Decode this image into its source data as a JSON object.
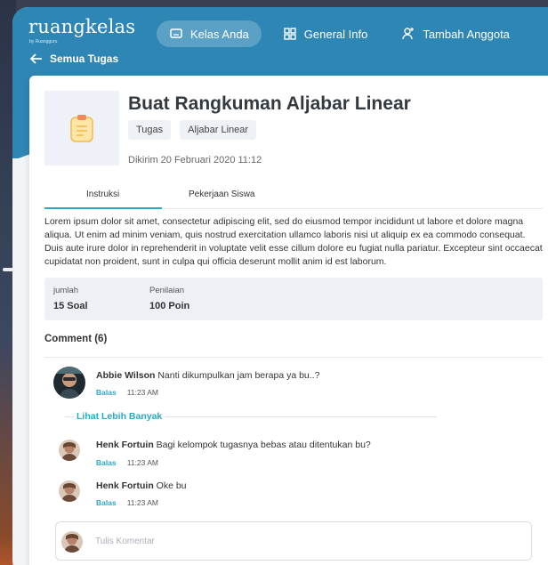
{
  "app": {
    "logo": "ruangkelas",
    "logo_sub": "by Ruangguru"
  },
  "nav": [
    {
      "label": "Kelas Anda",
      "icon": "monitor-icon",
      "active": true
    },
    {
      "label": "General Info",
      "icon": "grid-icon",
      "active": false
    },
    {
      "label": "Tambah Anggota",
      "icon": "add-user-icon",
      "active": false
    }
  ],
  "back": {
    "label": "Semua Tugas"
  },
  "assignment": {
    "title": "Buat Rangkuman Aljabar Linear",
    "tags": [
      "Tugas",
      "Aljabar Linear"
    ],
    "sent": "Dikirim 20 Februari 2020 11:12",
    "thumb_icon": "clipboard-icon"
  },
  "tabs": [
    {
      "label": "Instruksi",
      "active": true
    },
    {
      "label": "Pekerjaan Siswa",
      "active": false
    }
  ],
  "description": "Lorem ipsum dolor sit amet, consectetur adipiscing elit, sed do eiusmod tempor incididunt ut labore et dolore magna aliqua. Ut enim ad minim veniam, quis nostrud exercitation ullamco laboris nisi ut aliquip ex ea commodo consequat. Duis aute irure dolor in reprehenderit in voluptate velit esse cillum dolore eu fugiat nulla pariatur. Excepteur sint occaecat cupidatat non proident, sunt in culpa qui officia deserunt mollit anim id est laborum.",
  "stats": [
    {
      "label": "jumlah",
      "value": "15 Soal"
    },
    {
      "label": "Penilaian",
      "value": "100 Poin"
    }
  ],
  "comments_header": "Comment (6)",
  "comments": [
    {
      "author": "Abbie Wilson",
      "text": "Nanti dikumpulkan jam berapa ya bu..?",
      "reply": "Balas",
      "time": "11:23 AM"
    },
    {
      "author": "Henk Fortuin",
      "text": "Bagi kelompok tugasnya bebas atau ditentukan bu?",
      "reply": "Balas",
      "time": "11:23 AM"
    },
    {
      "author": "Henk Fortuin",
      "text": "Oke bu",
      "reply": "Balas",
      "time": "11:23 AM"
    }
  ],
  "more_label": "Lihat Lebih Banyak",
  "comment_input": {
    "placeholder": "Tulis Komentar"
  },
  "colors": {
    "primary": "#2e86b5",
    "accent": "#2aa8c4"
  }
}
